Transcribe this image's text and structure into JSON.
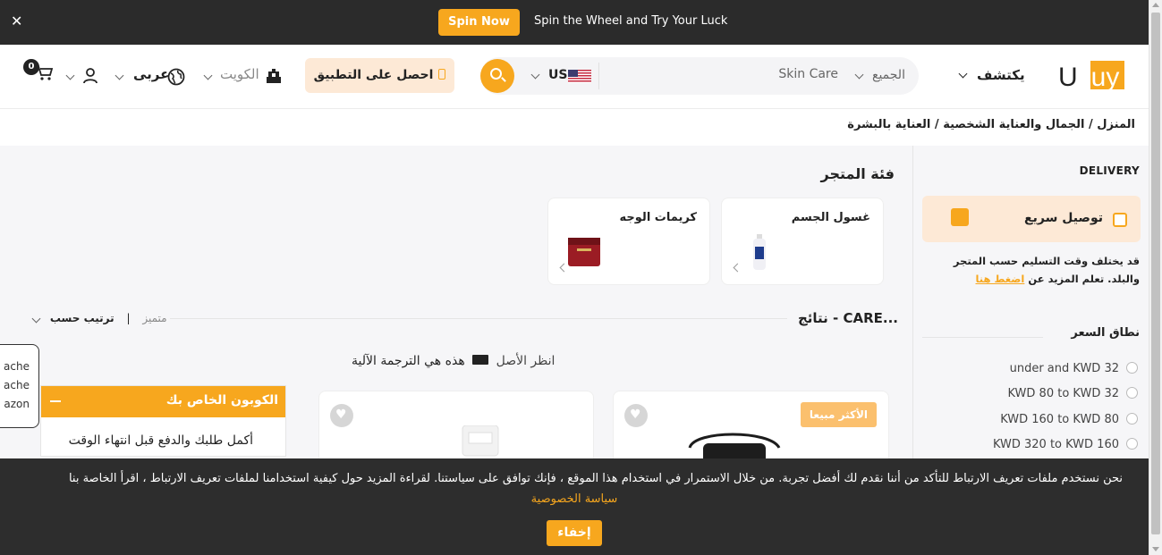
{
  "promo": {
    "close": "✕",
    "spin_button": "Spin Now",
    "spin_text": "Spin the Wheel and Try Your Luck"
  },
  "header": {
    "cart_count": "0",
    "language": "عربى",
    "country": "الكويت",
    "app_button": "احصل على التطبيق",
    "store_code": "US",
    "search_value": "Skin Care",
    "category": "الجميع",
    "discover": "يكتشف",
    "logo_text": "Ubuy"
  },
  "breadcrumb": "المنزل / الجمال والعناية الشخصية / العناية بالبشرة",
  "sidebar": {
    "delivery_title": "DELIVERY",
    "fast_delivery": "توصيل سريع",
    "delivery_note": "قد يختلف وقت التسليم حسب المتجر والبلد. تعلم المزيد عن",
    "click_here": "اضغط هنا",
    "price_range_title": "نطاق السعر",
    "price_options": [
      "under and KWD 32",
      "KWD 80 to KWD 32",
      "KWD 160 to KWD 80",
      "KWD 320 to KWD 160"
    ]
  },
  "main": {
    "store_category_title": "فئة المتجر",
    "categories": [
      {
        "name": "غسول الجسم"
      },
      {
        "name": "كريمات الوجه"
      }
    ],
    "results_title": "نتائج - CARE...",
    "sort_label": "ترتيب حسب",
    "sort_value": "متميز",
    "translation_note": "هذه هي الترجمة الآلية",
    "view_original": "انظر الأصل",
    "best_seller": "الأكثر مبيعا"
  },
  "coupon": {
    "title": "الكوبون الخاص بك",
    "body": "أكمل طلبك والدفع قبل انتهاء الوقت"
  },
  "tooltip": [
    "ache",
    "ache",
    "azon"
  ],
  "cookie": {
    "text": "نحن نستخدم ملفات تعريف الارتباط للتأكد من أننا نقدم لك أفضل تجربة. من خلال الاستمرار في استخدام هذا الموقع ، فإنك توافق على سياستنا. لقراءة المزيد حول كيفية استخدامنا لملفات تعريف الارتباط ، اقرأ الخاصة بنا",
    "policy_link": "سياسة الخصوصية",
    "hide_button": "إخفاء"
  },
  "colors": {
    "accent": "#f7a71e",
    "dark_bar": "#2b2b2b",
    "light_accent": "#fde9d6"
  }
}
